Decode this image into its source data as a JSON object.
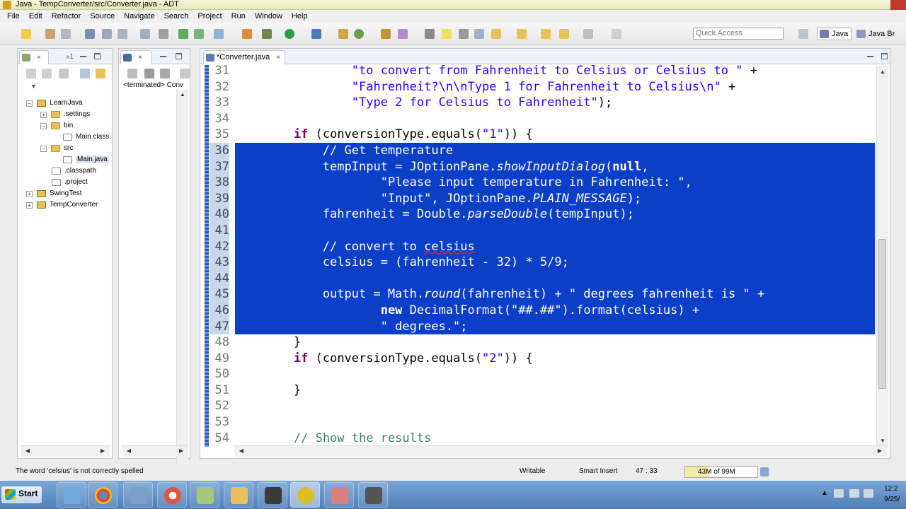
{
  "window": {
    "title": "Java - TempConverter/src/Converter.java - ADT"
  },
  "menu": [
    "File",
    "Edit",
    "Refactor",
    "Source",
    "Navigate",
    "Search",
    "Project",
    "Run",
    "Window",
    "Help"
  ],
  "toolbar": {
    "quick_access_placeholder": "Quick Access",
    "perspectives": [
      "Java",
      "Java Br"
    ]
  },
  "package_explorer": {
    "tab_icons": [
      "package-explorer",
      "hierarchy"
    ],
    "tree": [
      {
        "label": "LearnJava",
        "type": "project",
        "expanded": true
      },
      {
        "label": ".settings",
        "type": "folder"
      },
      {
        "label": "bin",
        "type": "folder",
        "expanded": true
      },
      {
        "label": "Main.class",
        "type": "file"
      },
      {
        "label": "src",
        "type": "folder",
        "expanded": true
      },
      {
        "label": "Main.java",
        "type": "java-file",
        "selected": true
      },
      {
        "label": ".classpath",
        "type": "file"
      },
      {
        "label": ".project",
        "type": "file"
      },
      {
        "label": "SwingTest",
        "type": "project"
      },
      {
        "label": "TempConverter",
        "type": "project"
      }
    ]
  },
  "console": {
    "tab_label": "",
    "terminated_text": "<terminated> Conv"
  },
  "editor": {
    "tab_label": "*Converter.java",
    "lines": [
      {
        "n": "31",
        "segs": [
          {
            "t": "                \"to convert from Fahrenheit to Celsius or Celsius to \"",
            "c": "str"
          },
          {
            "t": " +",
            "c": ""
          }
        ]
      },
      {
        "n": "32",
        "segs": [
          {
            "t": "                \"Fahrenheit?\\n\\nType 1 for Fahrenheit to Celsius\\n\"",
            "c": "str"
          },
          {
            "t": " +",
            "c": ""
          }
        ]
      },
      {
        "n": "33",
        "segs": [
          {
            "t": "                \"Type 2 for Celsius to Fahrenheit\"",
            "c": "str"
          },
          {
            "t": ");",
            "c": ""
          }
        ]
      },
      {
        "n": "34",
        "segs": []
      },
      {
        "n": "35",
        "segs": [
          {
            "t": "        ",
            "c": ""
          },
          {
            "t": "if",
            "c": "kw"
          },
          {
            "t": " (conversionType.equals(",
            "c": ""
          },
          {
            "t": "\"1\"",
            "c": "str"
          },
          {
            "t": ")) {",
            "c": ""
          }
        ]
      },
      {
        "n": "36",
        "sel": true,
        "segs": [
          {
            "t": "            ",
            "c": ""
          },
          {
            "t": "// Get temperature",
            "c": "cm"
          }
        ]
      },
      {
        "n": "37",
        "sel": true,
        "segs": [
          {
            "t": "            tempInput = JOptionPane.",
            "c": ""
          },
          {
            "t": "showInputDialog",
            "c": "it"
          },
          {
            "t": "(",
            "c": ""
          },
          {
            "t": "null",
            "c": "kw"
          },
          {
            "t": ",",
            "c": ""
          }
        ]
      },
      {
        "n": "38",
        "sel": true,
        "segs": [
          {
            "t": "                    ",
            "c": ""
          },
          {
            "t": "\"Please input temperature in Fahrenheit: \"",
            "c": "str"
          },
          {
            "t": ",",
            "c": ""
          }
        ]
      },
      {
        "n": "39",
        "sel": true,
        "segs": [
          {
            "t": "                    ",
            "c": ""
          },
          {
            "t": "\"Input\"",
            "c": "str"
          },
          {
            "t": ", JOptionPane.",
            "c": ""
          },
          {
            "t": "PLAIN_MESSAGE",
            "c": "it"
          },
          {
            "t": ");",
            "c": ""
          }
        ]
      },
      {
        "n": "40",
        "sel": true,
        "segs": [
          {
            "t": "            fahrenheit = Double.",
            "c": ""
          },
          {
            "t": "parseDouble",
            "c": "it"
          },
          {
            "t": "(tempInput);",
            "c": ""
          }
        ]
      },
      {
        "n": "41",
        "sel": true,
        "segs": []
      },
      {
        "n": "42",
        "sel": true,
        "segs": [
          {
            "t": "            ",
            "c": ""
          },
          {
            "t": "// convert to ",
            "c": "cm"
          },
          {
            "t": "celsius",
            "c": "cm squiggle"
          }
        ]
      },
      {
        "n": "43",
        "sel": true,
        "segs": [
          {
            "t": "            celsius = (fahrenheit - 32) * 5/9;",
            "c": ""
          }
        ]
      },
      {
        "n": "44",
        "sel": true,
        "segs": []
      },
      {
        "n": "45",
        "sel": true,
        "segs": [
          {
            "t": "            output = Math.",
            "c": ""
          },
          {
            "t": "round",
            "c": "it"
          },
          {
            "t": "(fahrenheit) + ",
            "c": ""
          },
          {
            "t": "\" degrees fahrenheit is \"",
            "c": "str"
          },
          {
            "t": " +",
            "c": ""
          }
        ]
      },
      {
        "n": "46",
        "sel": true,
        "segs": [
          {
            "t": "                    ",
            "c": ""
          },
          {
            "t": "new",
            "c": "kw"
          },
          {
            "t": " DecimalFormat(",
            "c": ""
          },
          {
            "t": "\"##.##\"",
            "c": "str"
          },
          {
            "t": ").format(celsius) +",
            "c": ""
          }
        ]
      },
      {
        "n": "47",
        "sel": true,
        "segs": [
          {
            "t": "                    ",
            "c": ""
          },
          {
            "t": "\" degrees.\"",
            "c": "str"
          },
          {
            "t": ";",
            "c": ""
          }
        ]
      },
      {
        "n": "48",
        "segs": [
          {
            "t": "        }",
            "c": ""
          }
        ]
      },
      {
        "n": "49",
        "segs": [
          {
            "t": "        ",
            "c": ""
          },
          {
            "t": "if",
            "c": "kw"
          },
          {
            "t": " (conversionType.equals(",
            "c": ""
          },
          {
            "t": "\"2\"",
            "c": "str"
          },
          {
            "t": ")) {",
            "c": ""
          }
        ]
      },
      {
        "n": "50",
        "segs": []
      },
      {
        "n": "51",
        "segs": [
          {
            "t": "        }",
            "c": ""
          }
        ]
      },
      {
        "n": "52",
        "segs": []
      },
      {
        "n": "53",
        "segs": []
      },
      {
        "n": "54",
        "segs": [
          {
            "t": "        ",
            "c": ""
          },
          {
            "t": "// Show the results",
            "c": "cm"
          }
        ]
      }
    ]
  },
  "status": {
    "message": "The word 'celsius' is not correctly spelled",
    "writable": "Writable",
    "insert_mode": "Smart Insert",
    "position": "47 : 33",
    "heap": "43M of 99M"
  },
  "taskbar": {
    "start_label": "Start",
    "apps": [
      "ADT",
      "Chrome",
      "Explorer",
      "Media",
      "Notepad",
      "Files",
      "Terminal",
      "ADT-Java",
      "Snipping",
      "Tool"
    ],
    "clock": [
      "12:2",
      "9/25/"
    ]
  },
  "colors": {
    "selection": "#0b3fc8",
    "keyword": "#7f0055",
    "string": "#2a00ff",
    "comment": "#3f7f5f"
  }
}
